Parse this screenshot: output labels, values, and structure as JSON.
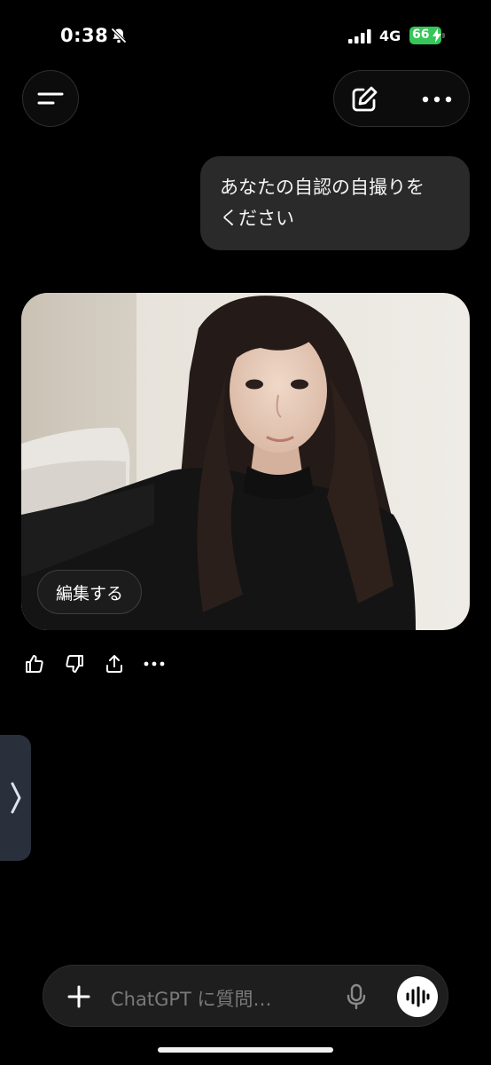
{
  "status_bar": {
    "time": "0:38",
    "network": "4G",
    "battery": "66",
    "icons": [
      "bell-slash-icon",
      "signal-icon",
      "battery-charging-icon"
    ]
  },
  "header": {
    "menu_icon": "menu-icon",
    "compose_icon": "compose-icon",
    "more_icon": "more-icon"
  },
  "conversation": {
    "user_message": {
      "line1": "あなたの自認の自撮りを",
      "line2": "ください"
    },
    "generated_image": {
      "description_icon": "photo-icon",
      "edit_label": "編集する"
    },
    "actions": [
      "thumbs-up-icon",
      "thumbs-down-icon",
      "share-icon",
      "more-icon"
    ]
  },
  "side_handle": {
    "icon": "chevron-right-icon"
  },
  "composer": {
    "placeholder": "ChatGPT に質問…",
    "add_icon": "plus-icon",
    "mic_icon": "mic-icon",
    "voice_icon": "voice-waveform-icon"
  },
  "colors": {
    "background": "#000000",
    "bubble": "#2a2a2a",
    "battery_green": "#35c759",
    "composer": "#1e1e1e"
  }
}
